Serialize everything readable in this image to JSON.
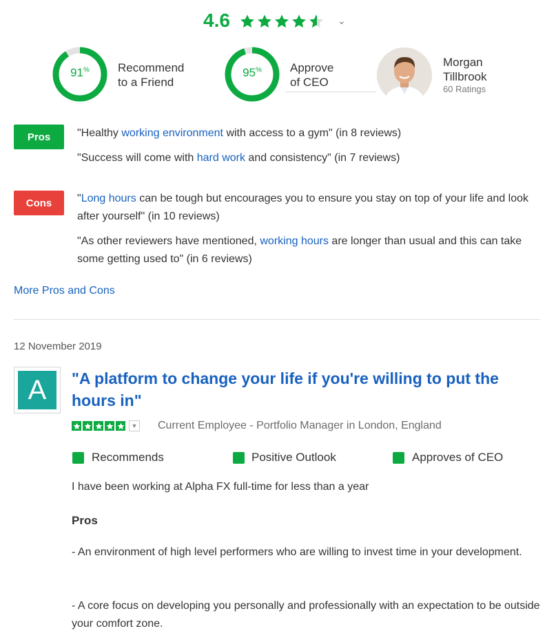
{
  "overall": {
    "rating": "4.6",
    "stars": 4.6
  },
  "stats": [
    {
      "value": "91",
      "unit": "%",
      "percent": 91,
      "label_line1": "Recommend",
      "label_line2": "to a Friend"
    },
    {
      "value": "95",
      "unit": "%",
      "percent": 95,
      "label_line1": "Approve",
      "label_line2": "of CEO"
    }
  ],
  "ceo": {
    "name_line1": "Morgan",
    "name_line2": "Tillbrook",
    "ratings": "60 Ratings"
  },
  "pros": {
    "label": "Pros",
    "quotes": [
      {
        "pre": "\"Healthy ",
        "link": "working environment",
        "post": " with access to a gym\" (in 8 reviews)"
      },
      {
        "pre": "\"Success will come with ",
        "link": "hard work",
        "post": " and consistency\" (in 7 reviews)"
      }
    ]
  },
  "cons": {
    "label": "Cons",
    "quotes": [
      {
        "pre": "\"",
        "link": "Long hours",
        "post": " can be tough but encourages you to ensure you stay on top of your life and look after yourself\" (in 10 reviews)"
      },
      {
        "pre": "\"As other reviewers have mentioned, ",
        "link": "working hours",
        "post": " are longer than usual and this can take some getting used to\" (in 6 reviews)"
      }
    ]
  },
  "more_link": "More Pros and Cons",
  "review": {
    "date": "12 November 2019",
    "logo_letter": "A",
    "title": "\"A platform to change your life if you're willing to put the hours in\"",
    "stars": 5,
    "employee": "Current Employee - Portfolio Manager in London, England",
    "checks": [
      "Recommends",
      "Positive Outlook",
      "Approves of CEO"
    ],
    "employment": "I have been working at Alpha FX full-time for less than a year",
    "pros_heading": "Pros",
    "pros_items": [
      "- An environment of high level performers who are willing to invest time in your development.",
      "- A core focus on developing you personally and professionally with an expectation to be outside your comfort zone."
    ]
  },
  "colors": {
    "green": "#0caa41",
    "red": "#e8403a",
    "link": "#1861bf",
    "teal": "#1aa69b"
  }
}
